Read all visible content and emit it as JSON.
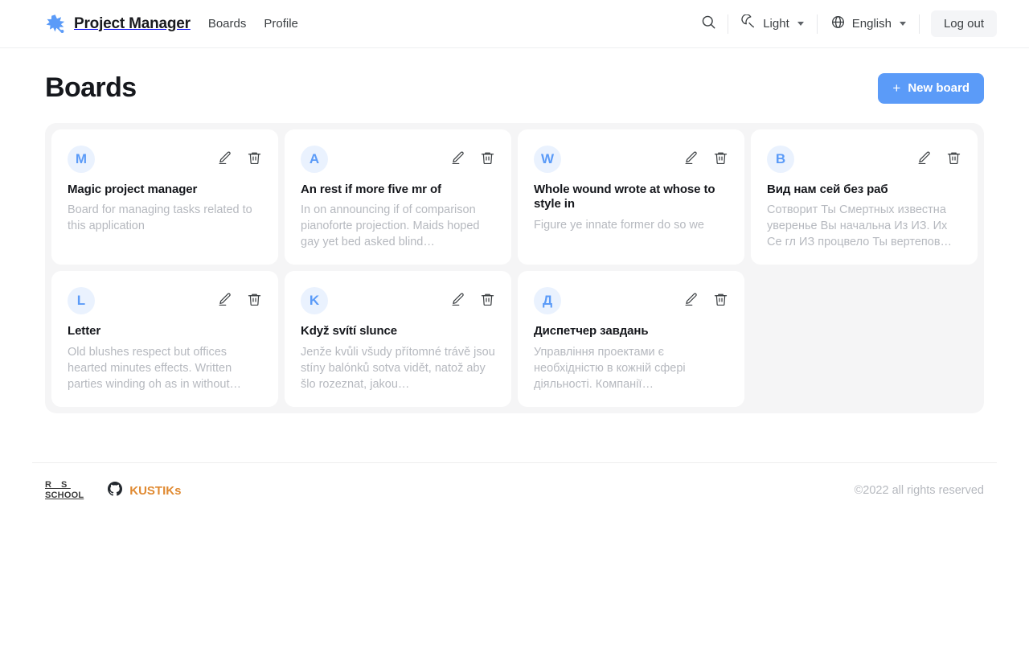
{
  "header": {
    "logo_icon": "star-splash-logo-icon",
    "brand_name": "Project Manager",
    "nav": [
      {
        "label": "Boards",
        "name": "nav-link-boards"
      },
      {
        "label": "Profile",
        "name": "nav-link-profile"
      }
    ],
    "search_icon": "search-icon",
    "theme": {
      "icon": "moon-ring-icon",
      "label": "Light",
      "caret": "chevron-down-icon"
    },
    "language": {
      "icon": "globe-icon",
      "label": "English",
      "caret": "chevron-down-icon"
    },
    "logout_label": "Log out"
  },
  "main": {
    "title": "Boards",
    "new_board": {
      "plus": "+",
      "label": "New board"
    }
  },
  "boards": [
    {
      "initial": "M",
      "title": "Magic project manager",
      "description": "Board for managing tasks related to this application",
      "edit_icon": "pencil-edit-icon",
      "delete_icon": "trash-delete-icon"
    },
    {
      "initial": "A",
      "title": "An rest if more five mr of",
      "description": "In on announcing if of comparison pianoforte projection. Maids hoped gay yet bed asked blind…",
      "edit_icon": "pencil-edit-icon",
      "delete_icon": "trash-delete-icon"
    },
    {
      "initial": "W",
      "title": "Whole wound wrote at whose to style in",
      "description": "Figure ye innate former do so we",
      "edit_icon": "pencil-edit-icon",
      "delete_icon": "trash-delete-icon"
    },
    {
      "initial": "В",
      "title": "Вид нам сей без раб",
      "description": "Сотворит Ты Смертных известна уверенье Вы начальна Из ИЗ. Их Се гл ИЗ процвело Ты вертепов…",
      "edit_icon": "pencil-edit-icon",
      "delete_icon": "trash-delete-icon"
    },
    {
      "initial": "L",
      "title": "Letter",
      "description": "Old blushes respect but offices hearted minutes effects. Written parties winding oh as in without…",
      "edit_icon": "pencil-edit-icon",
      "delete_icon": "trash-delete-icon"
    },
    {
      "initial": "K",
      "title": "Když svítí slunce",
      "description": "Jenže kvůli všudy přítomné trávě jsou stíny balónků sotva vidět, natož aby šlo rozeznat, jakou…",
      "edit_icon": "pencil-edit-icon",
      "delete_icon": "trash-delete-icon"
    },
    {
      "initial": "Д",
      "title": "Диспетчер завдань",
      "description": "Управління проектами є необхідністю в кожній сфері діяльності. Компанії…",
      "edit_icon": "pencil-edit-icon",
      "delete_icon": "trash-delete-icon"
    }
  ],
  "footer": {
    "rs_logo_top": "R  S",
    "rs_logo_bottom": "SCHOOL",
    "github_icon": "github-icon",
    "github_name": "KUSTIKs",
    "copyright": "©2022 all rights reserved"
  },
  "colors": {
    "accent": "#5b9bf8",
    "avatar_bg": "#eaf2fe",
    "shell_bg": "#f5f5f6",
    "muted_text": "#b6b9bf",
    "github_orange": "#e08a32"
  }
}
